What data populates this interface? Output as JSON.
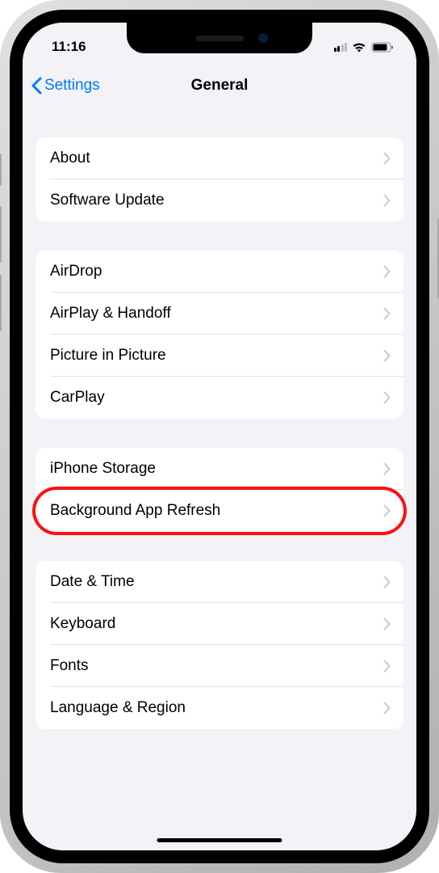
{
  "status_bar": {
    "time": "11:16"
  },
  "nav": {
    "back_label": "Settings",
    "title": "General"
  },
  "groups": [
    {
      "items": [
        {
          "label": "About",
          "name": "about"
        },
        {
          "label": "Software Update",
          "name": "software-update"
        }
      ]
    },
    {
      "items": [
        {
          "label": "AirDrop",
          "name": "airdrop"
        },
        {
          "label": "AirPlay & Handoff",
          "name": "airplay-handoff"
        },
        {
          "label": "Picture in Picture",
          "name": "picture-in-picture"
        },
        {
          "label": "CarPlay",
          "name": "carplay"
        }
      ]
    },
    {
      "items": [
        {
          "label": "iPhone Storage",
          "name": "iphone-storage"
        },
        {
          "label": "Background App Refresh",
          "name": "background-app-refresh",
          "highlighted": true
        }
      ]
    },
    {
      "items": [
        {
          "label": "Date & Time",
          "name": "date-time"
        },
        {
          "label": "Keyboard",
          "name": "keyboard"
        },
        {
          "label": "Fonts",
          "name": "fonts"
        },
        {
          "label": "Language & Region",
          "name": "language-region"
        }
      ]
    }
  ]
}
